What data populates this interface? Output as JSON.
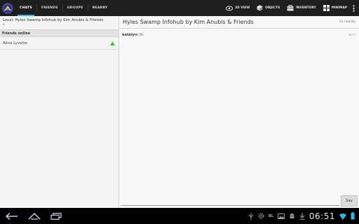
{
  "actionbar": {
    "tabs": [
      {
        "label": "CHATS",
        "active": true
      },
      {
        "label": "FRIENDS",
        "active": false
      },
      {
        "label": "GROUPS",
        "active": false
      },
      {
        "label": "NEARBY",
        "active": false
      }
    ],
    "actions": {
      "view3d": "3D VIEW",
      "objects": "OBJECTS",
      "inventory": "INVENTORY",
      "minimap": "MINIMAP"
    }
  },
  "left": {
    "local_chat": "Local: Hyles Swamp Infohub by Kim Anubis & Friends",
    "local_preview": "hi",
    "friends_header": "Friends online",
    "friends": [
      {
        "name": "Alina Lyvette",
        "status": "online"
      }
    ]
  },
  "chat": {
    "title": "Hyles Swamp Infohub by Kim Anubis & Friends",
    "nearby": "11 nearby",
    "messages": [
      {
        "sender": "katelyv:",
        "text": "hi",
        "time": "04:57"
      }
    ],
    "say_label": "Say"
  },
  "system": {
    "clock": "06:51",
    "bl_label": "BL"
  },
  "colors": {
    "accent": "#33b5e5",
    "online": "#3cc43c",
    "actionbar": "#1e1e1e"
  }
}
